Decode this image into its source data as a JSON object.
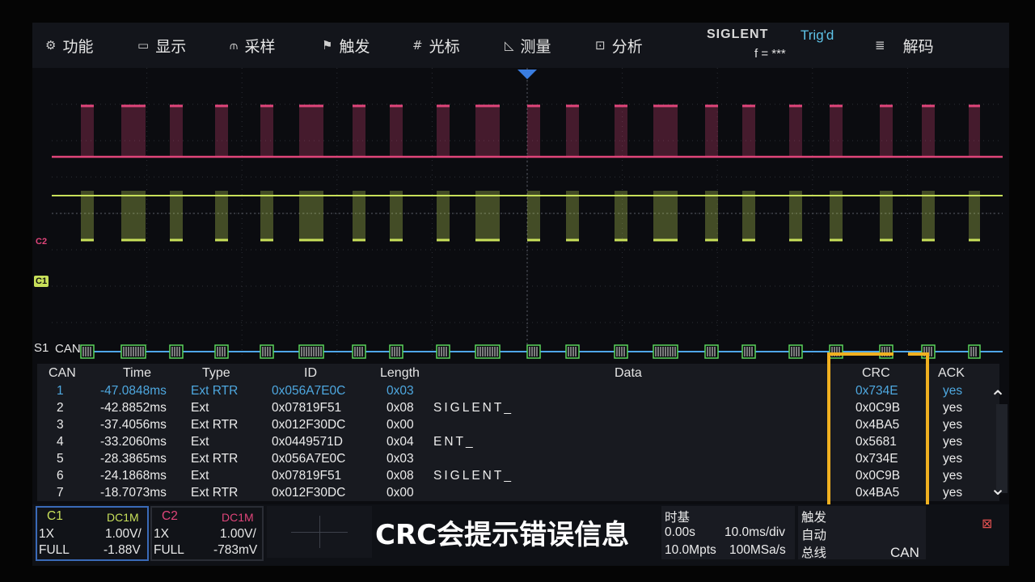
{
  "menu": {
    "items": [
      {
        "icon": "⚙",
        "label": "功能",
        "name": "function"
      },
      {
        "icon": "▭",
        "label": "显示",
        "name": "display"
      },
      {
        "icon": "⫙",
        "label": "采样",
        "name": "acquire"
      },
      {
        "icon": "⚑",
        "label": "触发",
        "name": "trigger"
      },
      {
        "icon": "#",
        "label": "光标",
        "name": "cursor"
      },
      {
        "icon": "◺",
        "label": "测量",
        "name": "measure"
      },
      {
        "icon": "⊡",
        "label": "分析",
        "name": "analysis"
      }
    ],
    "brand": "SIGLENT",
    "trig_status": "Trig'd",
    "frequency": "f = ***",
    "decode_icon": "≣",
    "decode_label": "解码"
  },
  "waveform": {
    "c2_label": "C2",
    "c1_label": "C1",
    "s1_label": "S1",
    "bus_label": "CAN",
    "c2_color": "#e0457a",
    "c1_color": "#c8e05a",
    "bus_color": "#4fa6e8"
  },
  "table": {
    "headers": {
      "can": "CAN",
      "time": "Time",
      "type": "Type",
      "id": "ID",
      "length": "Length",
      "data": "Data",
      "crc": "CRC",
      "ack": "ACK"
    },
    "rows": [
      {
        "can": "1",
        "time": "-47.0848ms",
        "type": "Ext RTR",
        "id": "0x056A7E0C",
        "length": "0x03",
        "data": "",
        "crc": "0x734E",
        "ack": "yes"
      },
      {
        "can": "2",
        "time": "-42.8852ms",
        "type": "Ext",
        "id": "0x07819F51",
        "length": "0x08",
        "data": "SIGLENT_",
        "crc": "0x0C9B",
        "ack": "yes"
      },
      {
        "can": "3",
        "time": "-37.4056ms",
        "type": "Ext RTR",
        "id": "0x012F30DC",
        "length": "0x00",
        "data": "",
        "crc": "0x4BA5",
        "ack": "yes"
      },
      {
        "can": "4",
        "time": "-33.2060ms",
        "type": "Ext",
        "id": "0x0449571D",
        "length": "0x04",
        "data": "ENT_",
        "crc": "0x5681",
        "ack": "yes"
      },
      {
        "can": "5",
        "time": "-28.3865ms",
        "type": "Ext RTR",
        "id": "0x056A7E0C",
        "length": "0x03",
        "data": "",
        "crc": "0x734E",
        "ack": "yes"
      },
      {
        "can": "6",
        "time": "-24.1868ms",
        "type": "Ext",
        "id": "0x07819F51",
        "length": "0x08",
        "data": "SIGLENT_",
        "crc": "0x0C9B",
        "ack": "yes"
      },
      {
        "can": "7",
        "time": "-18.7073ms",
        "type": "Ext RTR",
        "id": "0x012F30DC",
        "length": "0x00",
        "data": "",
        "crc": "0x4BA5",
        "ack": "yes"
      }
    ],
    "highlight_color": "#f0b020"
  },
  "status": {
    "c1": {
      "name": "C1",
      "coupling": "DC1M",
      "probe": "1X",
      "scale": "1.00V/",
      "bw": "FULL",
      "offset": "-1.88V"
    },
    "c2": {
      "name": "C2",
      "coupling": "DC1M",
      "probe": "1X",
      "scale": "1.00V/",
      "bw": "FULL",
      "offset": "-783mV"
    },
    "subtitle": "CRC会提示错误信息",
    "timebase": {
      "title": "时基",
      "delay": "0.00s",
      "scale": "10.0ms/div",
      "memory": "10.0Mpts",
      "rate": "100MSa/s"
    },
    "trigger": {
      "title": "触发",
      "mode": "自动",
      "type": "总线",
      "source": "CAN"
    }
  }
}
